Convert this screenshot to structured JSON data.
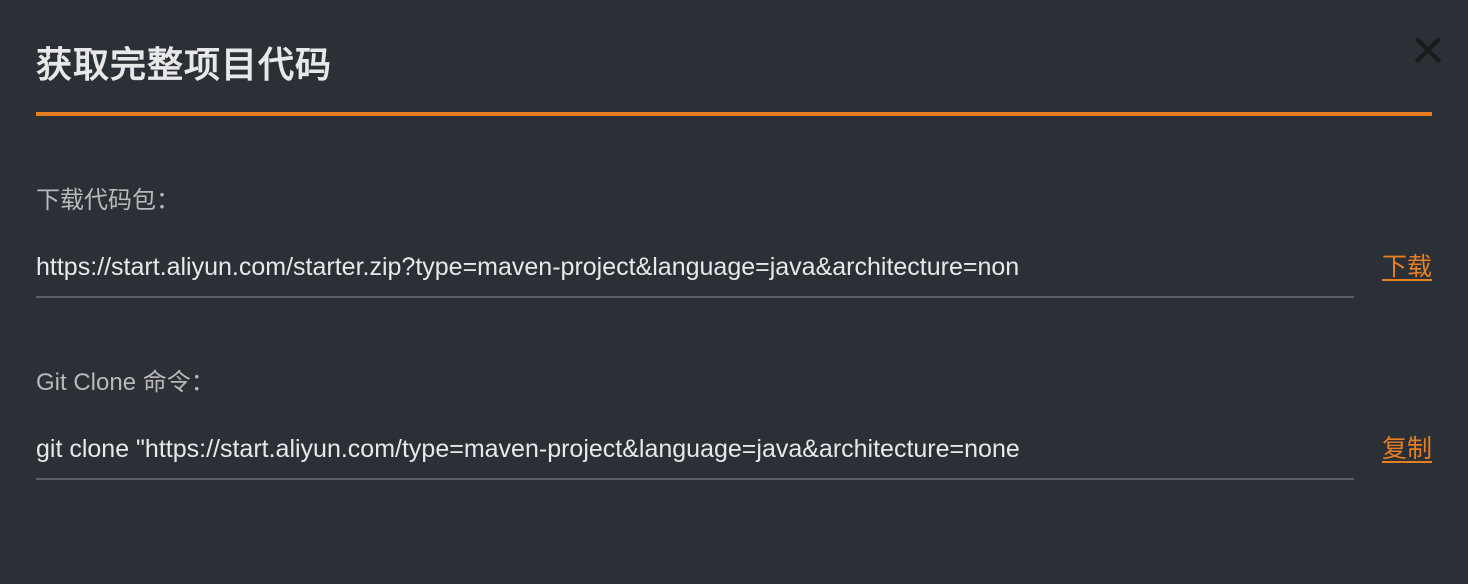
{
  "dialog": {
    "title": "获取完整项目代码"
  },
  "download": {
    "label": "下载代码包：",
    "url": "https://start.aliyun.com/starter.zip?type=maven-project&language=java&architecture=non",
    "action_label": "下载"
  },
  "gitclone": {
    "label": "Git Clone 命令：",
    "command": "git clone \"https://start.aliyun.com/type=maven-project&language=java&architecture=none",
    "action_label": "复制"
  }
}
